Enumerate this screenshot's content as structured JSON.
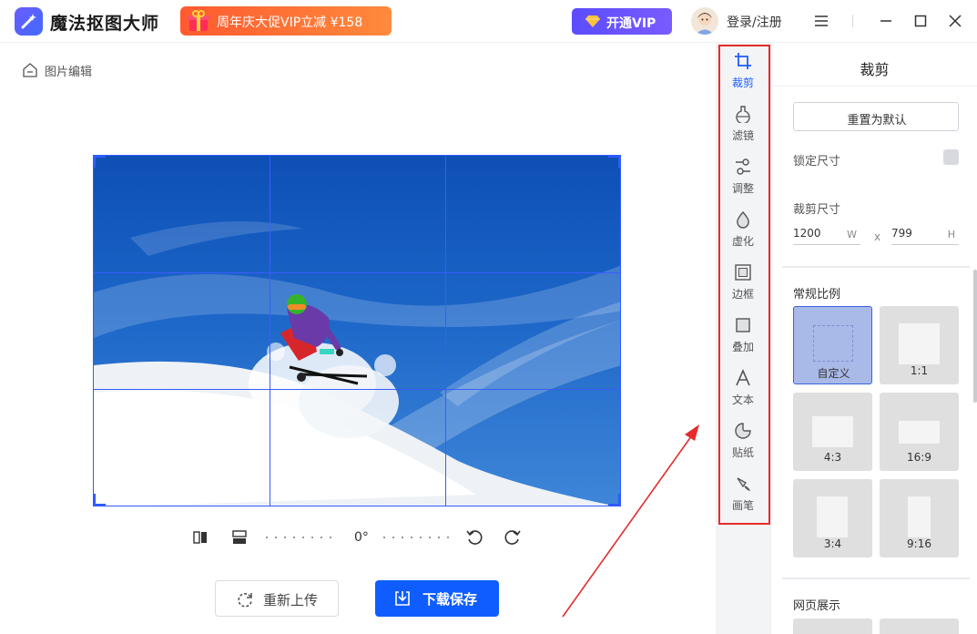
{
  "app": {
    "name": "魔法抠图大师",
    "promo_text": "周年庆大促VIP立减 ¥158",
    "vip_label": "开通VIP",
    "login_label": "登录/注册"
  },
  "breadcrumb": {
    "label": "图片编辑"
  },
  "rotate": {
    "angle": "0°"
  },
  "actions": {
    "reupload": "重新上传",
    "save": "下载保存"
  },
  "tools": [
    {
      "label": "裁剪",
      "icon": "crop-icon",
      "active": true
    },
    {
      "label": "滤镜",
      "icon": "filter-icon"
    },
    {
      "label": "调整",
      "icon": "adjust-icon"
    },
    {
      "label": "虚化",
      "icon": "blur-icon"
    },
    {
      "label": "边框",
      "icon": "frame-icon"
    },
    {
      "label": "叠加",
      "icon": "overlay-icon"
    },
    {
      "label": "文本",
      "icon": "text-icon"
    },
    {
      "label": "贴纸",
      "icon": "sticker-icon"
    },
    {
      "label": "画笔",
      "icon": "brush-icon"
    }
  ],
  "panel": {
    "title": "裁剪",
    "reset_label": "重置为默认",
    "lock_label": "锁定尺寸",
    "crop_size_label": "裁剪尺寸",
    "width": {
      "value": "1200",
      "unit": "W"
    },
    "x_label": "x",
    "height": {
      "value": "799",
      "unit": "H"
    },
    "ratio_heading": "常规比例",
    "ratios": [
      {
        "label": "自定义",
        "selected": true
      },
      {
        "label": "1:1"
      },
      {
        "label": "4:3"
      },
      {
        "label": "16:9"
      },
      {
        "label": "3:4"
      },
      {
        "label": "9:16"
      }
    ],
    "web_heading": "网页展示"
  },
  "colors": {
    "accent": "#0f5dff",
    "highlight": "#e52b2b",
    "vip": "#5a4dff",
    "promo": "#ff5a2f"
  }
}
